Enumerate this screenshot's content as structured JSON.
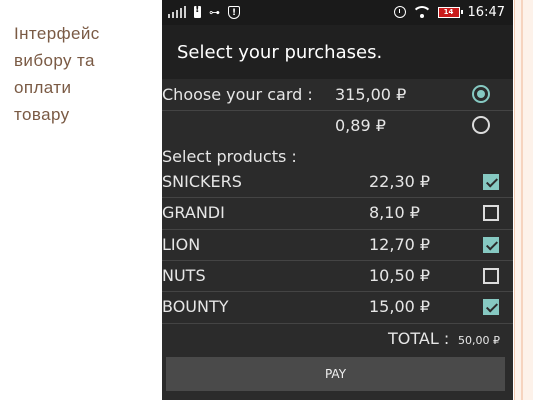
{
  "slide": {
    "caption_lines": [
      "Інтерфейс",
      "вибору та",
      "оплати",
      "товару"
    ]
  },
  "statusbar": {
    "clock": "16:47",
    "battery_level": "14",
    "left_icons": [
      "signal-icon",
      "battery-alert-icon",
      "key-icon",
      "shield-alert-icon"
    ],
    "right_icons": [
      "alarm-icon",
      "wifi-icon",
      "battery-icon"
    ]
  },
  "app": {
    "title": "Select your purchases."
  },
  "cards": {
    "label": "Choose your card :",
    "options": [
      {
        "amount": "315,00 ₽",
        "selected": true
      },
      {
        "amount": "0,89 ₽",
        "selected": false
      }
    ]
  },
  "products": {
    "label": "Select products :",
    "items": [
      {
        "name": "SNICKERS",
        "price": "22,30 ₽",
        "checked": true
      },
      {
        "name": "GRANDI",
        "price": "8,10 ₽",
        "checked": false
      },
      {
        "name": "LION",
        "price": "12,70 ₽",
        "checked": true
      },
      {
        "name": "NUTS",
        "price": "10,50 ₽",
        "checked": false
      },
      {
        "name": "BOUNTY",
        "price": "15,00 ₽",
        "checked": true
      }
    ]
  },
  "total": {
    "label": "TOTAL :",
    "value": "50,00 ₽"
  },
  "pay_button": {
    "label": "PAY"
  },
  "colors": {
    "accent": "#86c9c2",
    "screen_bg": "#2b2b2b",
    "caption_text": "#7a5a44"
  }
}
